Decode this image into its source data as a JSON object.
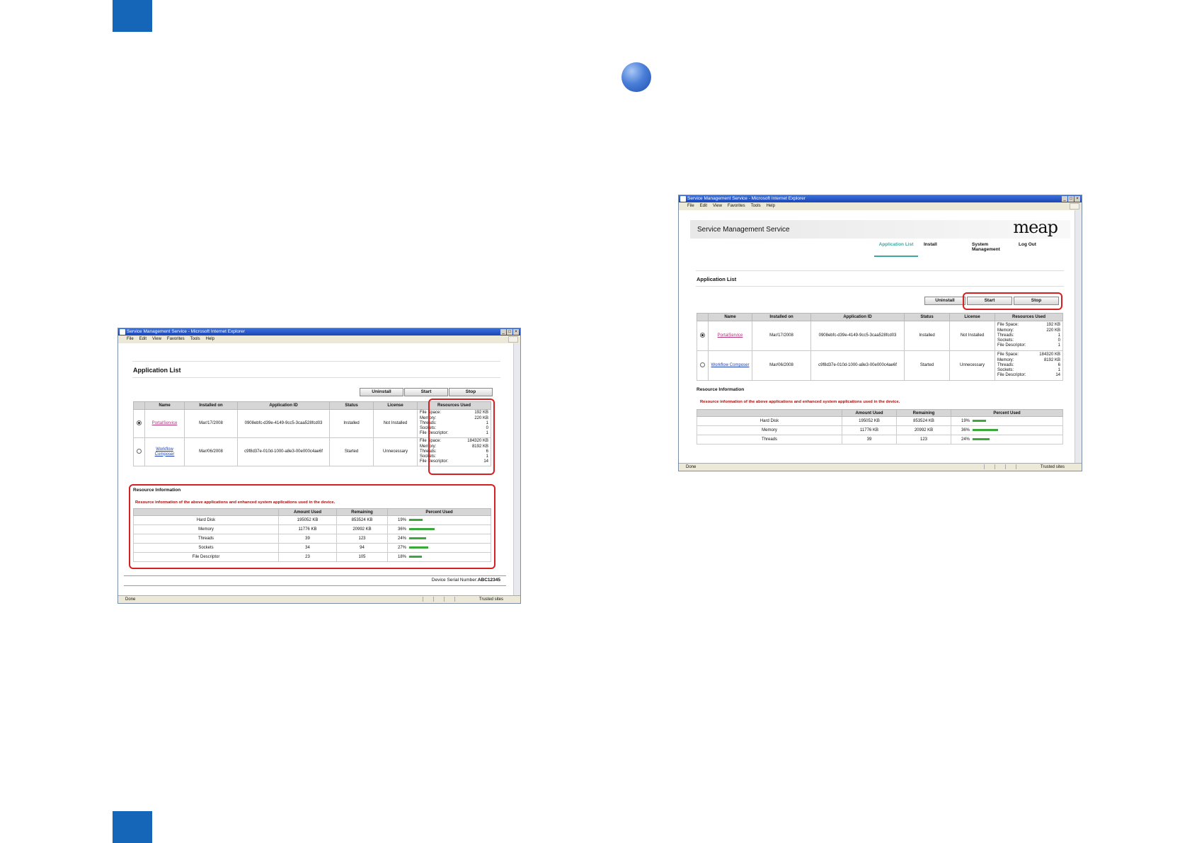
{
  "window": {
    "title": "Service Management Service - Microsoft Internet Explorer",
    "menu": [
      "File",
      "Edit",
      "View",
      "Favorites",
      "Tools",
      "Help"
    ],
    "status_done": "Done",
    "status_zone": "Trusted sites"
  },
  "page": {
    "service_title": "Service Management Service",
    "logo": "meap",
    "nav": [
      "Application List",
      "Install",
      "System Management",
      "Log Out"
    ],
    "section_title": "Application List",
    "buttons": {
      "uninstall": "Uninstall",
      "start": "Start",
      "stop": "Stop"
    },
    "table_headers": [
      "Name",
      "Installed on",
      "Application ID",
      "Status",
      "License",
      "Resources Used"
    ],
    "apps": [
      {
        "name": "PortalService",
        "installed_on": "Mar/17/2008",
        "app_id": "0908ebfc-d39e-4149-9cc5-3caa528fcd03",
        "status": "Installed",
        "license": "Not Installed",
        "selected": true,
        "resources": [
          [
            "File Space:",
            "192 KB"
          ],
          [
            "Memory:",
            "220 KB"
          ],
          [
            "Threads:",
            "1"
          ],
          [
            "Sockets:",
            "0"
          ],
          [
            "File Descriptor:",
            "1"
          ]
        ]
      },
      {
        "name": "Workflow Composer",
        "installed_on": "Mar/06/2008",
        "app_id": "c9f8d37e-010d-1000-a8e3-00e000c4ae6f",
        "status": "Started",
        "license": "Unnecessary",
        "selected": false,
        "resources": [
          [
            "File Space:",
            "184320 KB"
          ],
          [
            "Memory:",
            "8192 KB"
          ],
          [
            "Threads:",
            "6"
          ],
          [
            "Sockets:",
            "1"
          ],
          [
            "File Descriptor:",
            "14"
          ]
        ]
      }
    ],
    "resource_info_title": "Resource Information",
    "resource_info_note": "Resource information of the above applications and enhanced system applications used in the device.",
    "resource_headers": [
      "",
      "Amount Used",
      "Remaining",
      "Percent Used"
    ],
    "resources": [
      {
        "label": "Hard Disk",
        "used": "195052 KB",
        "remaining": "853524 KB",
        "percent": 19,
        "percent_label": "19%"
      },
      {
        "label": "Memory",
        "used": "11776 KB",
        "remaining": "20992 KB",
        "percent": 36,
        "percent_label": "36%"
      },
      {
        "label": "Threads",
        "used": "39",
        "remaining": "123",
        "percent": 24,
        "percent_label": "24%"
      },
      {
        "label": "Sockets",
        "used": "34",
        "remaining": "94",
        "percent": 27,
        "percent_label": "27%"
      },
      {
        "label": "File Descriptor",
        "used": "23",
        "remaining": "105",
        "percent": 18,
        "percent_label": "18%"
      }
    ],
    "serial_label": "Device Serial Number:",
    "serial_value": "ABC12345"
  },
  "colors": {
    "tab_blue": "#1566b8",
    "highlight_red": "#d42020",
    "bar_green": "#3aa83a",
    "title_blue": "#1b46b8"
  }
}
